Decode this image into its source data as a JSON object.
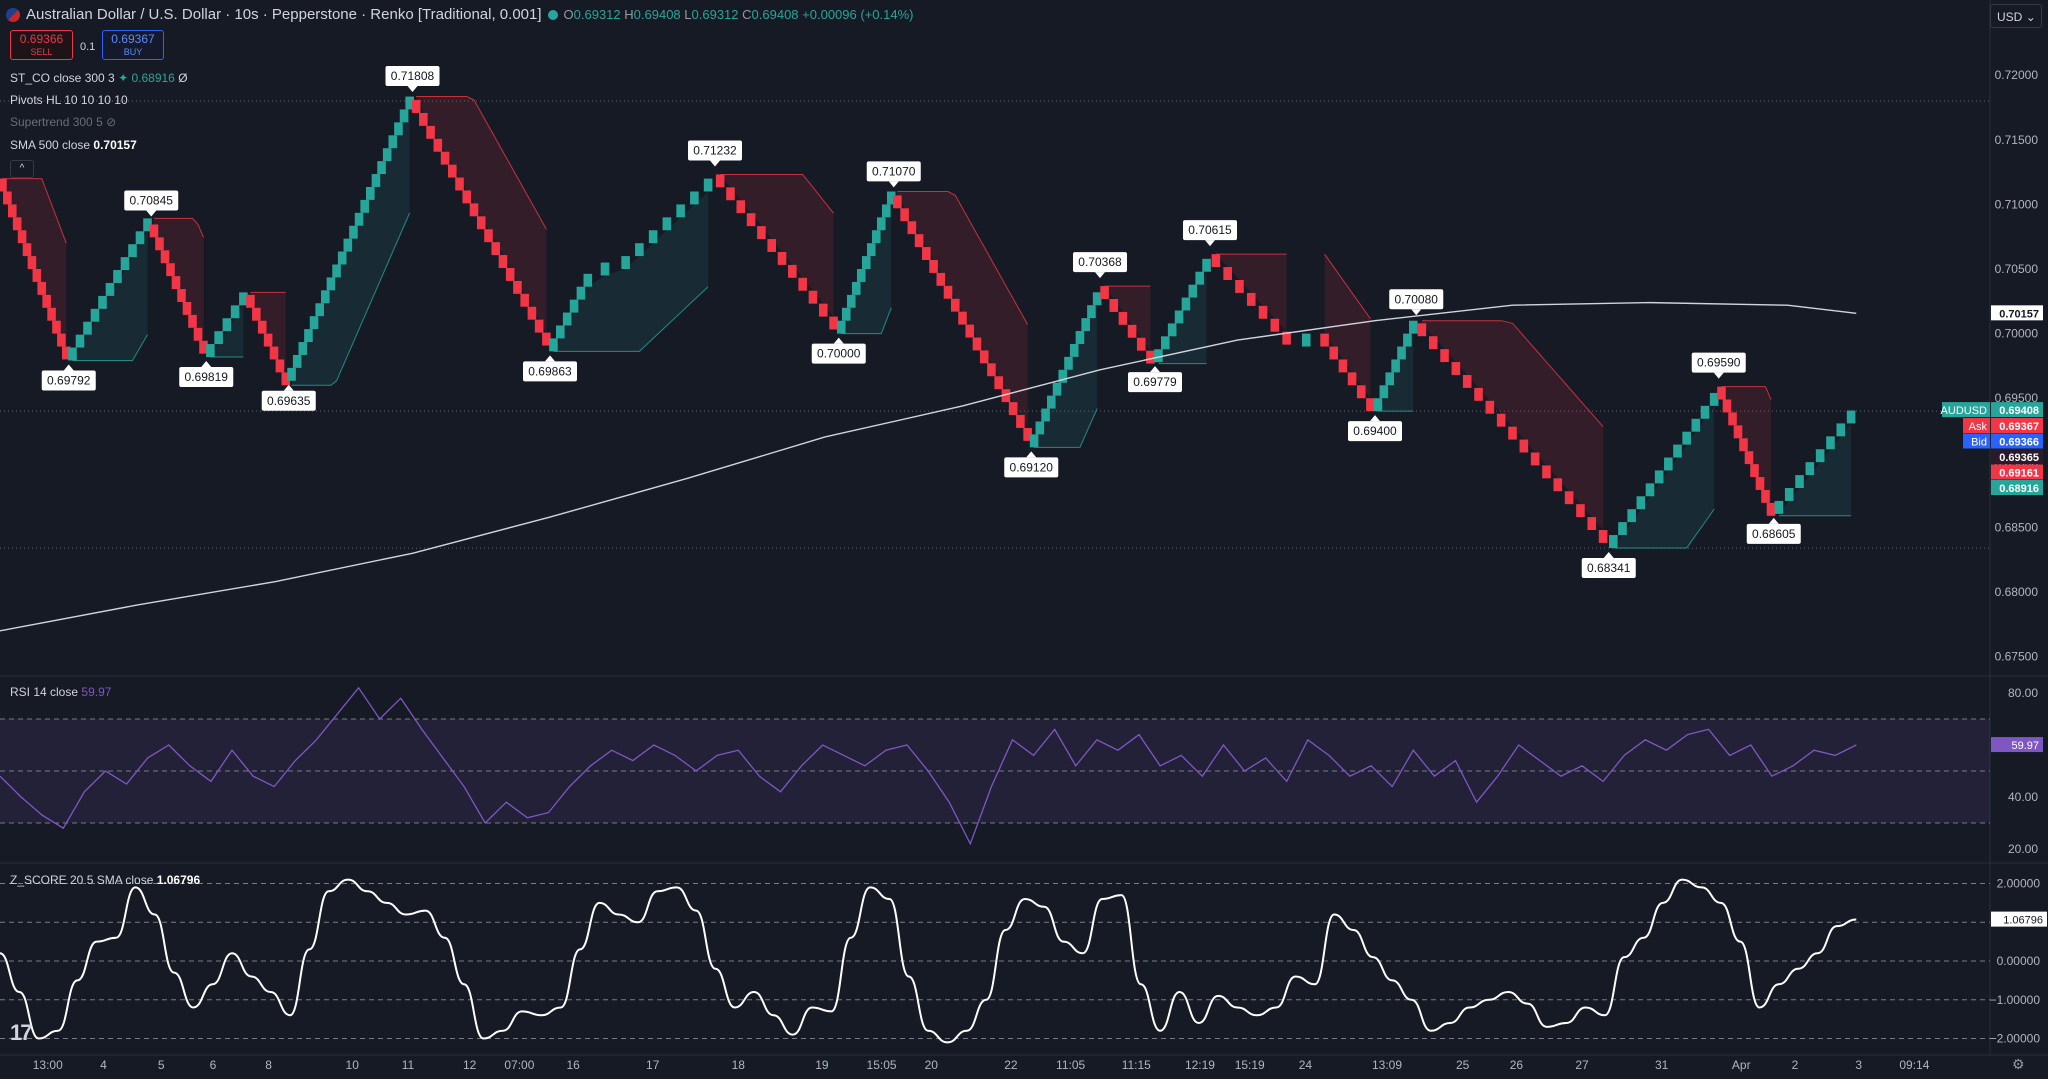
{
  "header": {
    "title": "Australian Dollar / U.S. Dollar · 10s · Pepperstone · Renko [Traditional, 0.001]",
    "ohlc": [
      {
        "k": "O",
        "v": "0.69312"
      },
      {
        "k": "H",
        "v": "0.69408"
      },
      {
        "k": "L",
        "v": "0.69312"
      },
      {
        "k": "C",
        "v": "0.69408"
      }
    ],
    "change": "+0.00096 (+0.14%)"
  },
  "trade": {
    "sell_price": "0.69366",
    "sell_label": "SELL",
    "spread": "0.1",
    "buy_price": "0.69367",
    "buy_label": "BUY"
  },
  "legends": {
    "st": {
      "name": "ST_CO close 300 3",
      "value": "0.68916",
      "suffix": "Ø"
    },
    "pivots": {
      "name": "Pivots HL 10 10 10 10"
    },
    "supertrend": {
      "name": "Supertrend 300 5"
    },
    "sma": {
      "name": "SMA 500 close",
      "value": "0.70157"
    },
    "collapse": "^"
  },
  "currency": "USD",
  "colors": {
    "up": "#26a69a",
    "down": "#f23645",
    "sma": "#d1d4dc",
    "rsi": "#7e57c2",
    "zscore": "#ffffff",
    "bg": "#161a25",
    "grid": "#2a2e39"
  },
  "chart_data": [
    {
      "type": "renko",
      "title": "Australian Dollar / U.S. Dollar · 10s · Pepperstone · Renko [Traditional, 0.001]",
      "brick_size": 0.001,
      "ylim": [
        0.6735,
        0.7235
      ],
      "y_ticks": [
        "0.72000",
        "0.71500",
        "0.71000",
        "0.70500",
        "0.70000",
        "0.69500",
        "0.69000",
        "0.68500",
        "0.68000",
        "0.67500"
      ],
      "pivots": [
        {
          "t": 0.0,
          "v": 0.712
        },
        {
          "t": 2.5,
          "v": 0.69792,
          "type": "low",
          "label": "0.69792"
        },
        {
          "t": 5.5,
          "v": 0.70845,
          "type": "high",
          "label": "0.70845"
        },
        {
          "t": 7.5,
          "v": 0.69819,
          "type": "low",
          "label": "0.69819"
        },
        {
          "t": 9.0,
          "v": 0.703
        },
        {
          "t": 10.5,
          "v": 0.69635,
          "type": "low",
          "label": "0.69635"
        },
        {
          "t": 15.0,
          "v": 0.71808,
          "type": "high",
          "label": "0.71808"
        },
        {
          "t": 20.0,
          "v": 0.69863,
          "type": "low",
          "label": "0.69863"
        },
        {
          "t": 21.5,
          "v": 0.7045
        },
        {
          "t": 22.5,
          "v": 0.705
        },
        {
          "t": 26.0,
          "v": 0.71232,
          "type": "high",
          "label": "0.71232"
        },
        {
          "t": 30.5,
          "v": 0.7,
          "type": "low",
          "label": "0.70000"
        },
        {
          "t": 32.5,
          "v": 0.7107,
          "type": "high",
          "label": "0.71070"
        },
        {
          "t": 37.5,
          "v": 0.6912,
          "type": "low",
          "label": "0.69120"
        },
        {
          "t": 40.0,
          "v": 0.70368,
          "type": "high",
          "label": "0.70368"
        },
        {
          "t": 42.0,
          "v": 0.69779,
          "type": "low",
          "label": "0.69779"
        },
        {
          "t": 44.0,
          "v": 0.70615,
          "type": "high",
          "label": "0.70615"
        },
        {
          "t": 47.0,
          "v": 0.699
        },
        {
          "t": 48.0,
          "v": 0.7
        },
        {
          "t": 50.0,
          "v": 0.694,
          "type": "low",
          "label": "0.69400"
        },
        {
          "t": 51.5,
          "v": 0.7008,
          "type": "high",
          "label": "0.70080"
        },
        {
          "t": 58.5,
          "v": 0.68341,
          "type": "low",
          "label": "0.68341"
        },
        {
          "t": 62.5,
          "v": 0.6959,
          "type": "high",
          "label": "0.69590"
        },
        {
          "t": 64.5,
          "v": 0.68605,
          "type": "low",
          "label": "0.68605"
        },
        {
          "t": 67.5,
          "v": 0.69408
        }
      ],
      "sma_500": [
        {
          "t": 0,
          "v": 0.677
        },
        {
          "t": 5,
          "v": 0.679
        },
        {
          "t": 10,
          "v": 0.6808
        },
        {
          "t": 15,
          "v": 0.683
        },
        {
          "t": 20,
          "v": 0.6858
        },
        {
          "t": 25,
          "v": 0.6888
        },
        {
          "t": 30,
          "v": 0.692
        },
        {
          "t": 35,
          "v": 0.6944
        },
        {
          "t": 40,
          "v": 0.6972
        },
        {
          "t": 45,
          "v": 0.6995
        },
        {
          "t": 50,
          "v": 0.701
        },
        {
          "t": 55,
          "v": 0.7022
        },
        {
          "t": 60,
          "v": 0.7024
        },
        {
          "t": 65,
          "v": 0.7022
        },
        {
          "t": 67.5,
          "v": 0.70157
        }
      ],
      "horizontal_levels": [
        0.718,
        0.694,
        0.6834
      ],
      "price_tags": [
        {
          "label": "",
          "value": "0.70157",
          "bg": "#ffffff",
          "fg": "#131722",
          "price": 0.70157
        },
        {
          "label": "AUDUSD",
          "value": "0.69408",
          "bg": "#26a69a",
          "fg": "#ffffff",
          "price": 0.69408
        },
        {
          "label": "Ask",
          "value": "0.69367",
          "bg": "#f23645",
          "fg": "#ffffff",
          "price": 0.69285
        },
        {
          "label": "Bid",
          "value": "0.69366",
          "bg": "#2962ff",
          "fg": "#ffffff",
          "price": 0.69165
        },
        {
          "label": "",
          "value": "0.69365",
          "bg": "#2a1a2a",
          "fg": "#ffffff",
          "price": 0.69045
        },
        {
          "label": "",
          "value": "0.69161",
          "bg": "#f23645",
          "fg": "#ffffff",
          "price": 0.68925
        },
        {
          "label": "",
          "value": "0.68916",
          "bg": "#26a69a",
          "fg": "#ffffff",
          "price": 0.68805
        }
      ]
    },
    {
      "type": "line",
      "title": "RSI 14 close",
      "value": "59.97",
      "ylim": [
        15,
        85
      ],
      "y_ticks": [
        "80.00",
        "60.00",
        "40.00",
        "20.00"
      ],
      "bands": [
        70,
        30
      ],
      "mid": 50,
      "values": [
        48,
        40,
        33,
        28,
        42,
        50,
        45,
        55,
        60,
        52,
        46,
        58,
        48,
        44,
        54,
        62,
        72,
        82,
        70,
        78,
        66,
        55,
        44,
        30,
        38,
        32,
        34,
        44,
        52,
        58,
        54,
        60,
        56,
        50,
        56,
        58,
        48,
        42,
        52,
        60,
        56,
        52,
        58,
        60,
        50,
        38,
        22,
        44,
        62,
        56,
        66,
        52,
        62,
        58,
        64,
        52,
        56,
        48,
        60,
        50,
        55,
        46,
        62,
        56,
        48,
        52,
        44,
        58,
        48,
        54,
        38,
        48,
        60,
        54,
        48,
        52,
        46,
        56,
        62,
        58,
        64,
        66,
        56,
        60,
        48,
        52,
        58,
        56,
        60
      ]
    },
    {
      "type": "line",
      "title": "Z_SCORE 20 5 SMA close",
      "value": "1.06796",
      "ylim": [
        -2.4,
        2.4
      ],
      "y_ticks": [
        "2.00000",
        "1.00000",
        "0.00000",
        "−1.00000",
        "−2.00000"
      ],
      "levels": [
        2,
        1,
        0,
        -1,
        -2
      ],
      "values": [
        0.2,
        -0.8,
        -2.0,
        -1.8,
        -0.5,
        0.5,
        0.6,
        1.9,
        1.2,
        -0.3,
        -1.2,
        -0.6,
        0.2,
        -0.4,
        -0.8,
        -1.4,
        0.3,
        1.8,
        2.1,
        1.8,
        1.5,
        1.2,
        1.3,
        0.6,
        -0.6,
        -2.0,
        -1.8,
        -1.3,
        -1.4,
        -1.2,
        0.3,
        1.5,
        1.2,
        1.0,
        1.8,
        1.9,
        1.3,
        -0.2,
        -1.2,
        -0.8,
        -1.4,
        -1.9,
        -1.2,
        -1.3,
        0.6,
        1.9,
        1.6,
        -0.4,
        -1.8,
        -2.1,
        -1.8,
        -1.0,
        0.8,
        1.6,
        1.4,
        0.5,
        0.2,
        1.6,
        1.7,
        -0.6,
        -1.8,
        -0.8,
        -1.6,
        -0.9,
        -1.2,
        -1.4,
        -1.2,
        -0.4,
        -0.6,
        1.2,
        0.8,
        0.1,
        -0.5,
        -1.0,
        -1.8,
        -1.6,
        -1.2,
        -1.0,
        -0.8,
        -1.1,
        -1.7,
        -1.6,
        -1.2,
        -1.4,
        0.1,
        0.6,
        1.5,
        2.1,
        1.9,
        1.5,
        0.5,
        -1.2,
        -0.6,
        -0.2,
        0.2,
        0.9,
        1.07
      ]
    }
  ],
  "time_axis": [
    "13:00",
    "4",
    "5",
    "6",
    "8",
    "10",
    "11",
    "12",
    "07:00",
    "16",
    "17",
    "18",
    "19",
    "15:05",
    "20",
    "22",
    "11:05",
    "11:15",
    "12:19",
    "15:19",
    "24",
    "13:09",
    "25",
    "26",
    "27",
    "31",
    "Apr",
    "2",
    "3",
    "09:14"
  ],
  "time_axis_pos": [
    0.024,
    0.052,
    0.081,
    0.107,
    0.135,
    0.177,
    0.205,
    0.236,
    0.261,
    0.288,
    0.328,
    0.371,
    0.413,
    0.443,
    0.468,
    0.508,
    0.538,
    0.571,
    0.603,
    0.628,
    0.656,
    0.697,
    0.735,
    0.762,
    0.795,
    0.835,
    0.875,
    0.902,
    0.934,
    0.962
  ]
}
